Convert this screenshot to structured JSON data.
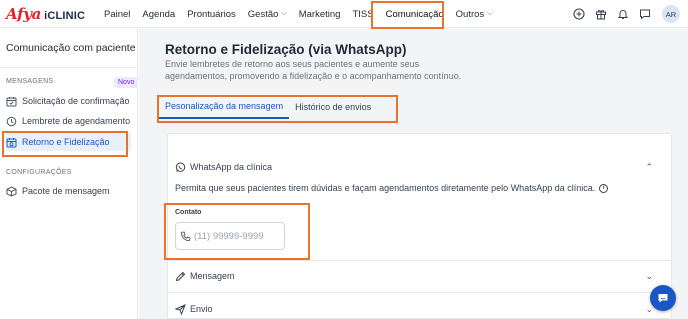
{
  "brand": {
    "logo_text": "Afya",
    "product": "iCLINIC"
  },
  "nav": {
    "items": [
      {
        "label": "Painel",
        "dropdown": false
      },
      {
        "label": "Agenda",
        "dropdown": false
      },
      {
        "label": "Prontuários",
        "dropdown": false
      },
      {
        "label": "Gestão",
        "dropdown": true
      },
      {
        "label": "Marketing",
        "dropdown": false
      },
      {
        "label": "TISS",
        "dropdown": false
      },
      {
        "label": "Comunicação",
        "dropdown": false,
        "active": true
      },
      {
        "label": "Outros",
        "dropdown": true
      }
    ],
    "icons": [
      "plus-circle-icon",
      "gift-icon",
      "bell-icon",
      "chat-icon"
    ],
    "avatar_initials": "AR"
  },
  "sidebar": {
    "title": "Comunicação com paciente",
    "sections": [
      {
        "label": "MENSAGENS",
        "badge": "Novo",
        "items": [
          {
            "label": "Solicitação de confirmação",
            "icon": "calendar-check-icon"
          },
          {
            "label": "Lembrete de agendamento",
            "icon": "clock-icon"
          },
          {
            "label": "Retorno e Fidelização",
            "icon": "calendar-refresh-icon",
            "active": true
          }
        ]
      },
      {
        "label": "CONFIGURAÇÕES",
        "items": [
          {
            "label": "Pacote de mensagem",
            "icon": "package-icon"
          }
        ]
      }
    ]
  },
  "main": {
    "title": "Retorno e Fidelização (via WhatsApp)",
    "description": "Envie lembretes de retorno aos seus pacientes e aumente seus agendamentos, promovendo a fidelização e o acompanhamento contínuo.",
    "tabs": [
      {
        "label": "Pesonalização da mensagem",
        "active": true
      },
      {
        "label": "Histórico de envios",
        "active": false
      }
    ],
    "sections": {
      "whatsapp": {
        "title": "WhatsApp da clínica",
        "expanded": true,
        "description": "Permita que seus pacientes tirem dúvidas e façam agendamentos diretamente pelo WhatsApp da clínica.",
        "field_label": "Contato",
        "phone_value": "",
        "phone_placeholder": "(11) 99999-9999"
      },
      "message": {
        "title": "Mensagem",
        "expanded": false
      },
      "send": {
        "title": "Envio",
        "expanded": false
      }
    }
  },
  "colors": {
    "accent": "#1a56c4",
    "highlight_box": "#e8742c",
    "brand_red": "#e4202a",
    "badge_bg": "#ede9fe",
    "badge_text": "#6d28d9"
  }
}
